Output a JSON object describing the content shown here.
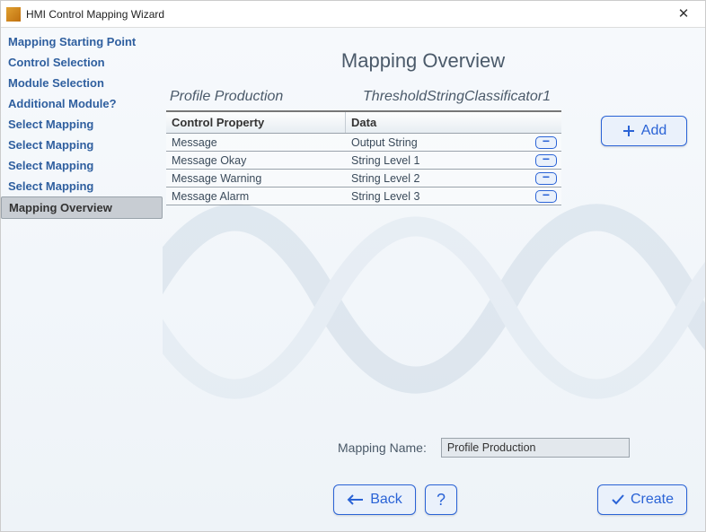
{
  "window": {
    "title": "HMI Control Mapping Wizard"
  },
  "sidebar": {
    "steps": [
      {
        "label": "Mapping Starting Point"
      },
      {
        "label": "Control Selection"
      },
      {
        "label": "Module Selection"
      },
      {
        "label": "Additional Module?"
      },
      {
        "label": "Select Mapping"
      },
      {
        "label": "Select Mapping"
      },
      {
        "label": "Select Mapping"
      },
      {
        "label": "Select Mapping"
      },
      {
        "label": "Mapping Overview"
      }
    ],
    "active_index": 8
  },
  "main": {
    "heading": "Mapping Overview",
    "profile_label": "Profile Production",
    "classifier_label": "ThresholdStringClassificator1",
    "table": {
      "headers": {
        "c1": "Control Property",
        "c2": "Data"
      },
      "rows": [
        {
          "property": "Message",
          "data": "Output String"
        },
        {
          "property": "Message Okay",
          "data": "String Level 1"
        },
        {
          "property": "Message Warning",
          "data": "String Level 2"
        },
        {
          "property": "Message Alarm",
          "data": "String Level 3"
        }
      ]
    },
    "mapping_name_label": "Mapping Name:",
    "mapping_name_value": "Profile Production"
  },
  "buttons": {
    "add": "Add",
    "back": "Back",
    "help": "?",
    "create": "Create",
    "remove_glyph": "−"
  },
  "colors": {
    "accent": "#2a63d6"
  }
}
